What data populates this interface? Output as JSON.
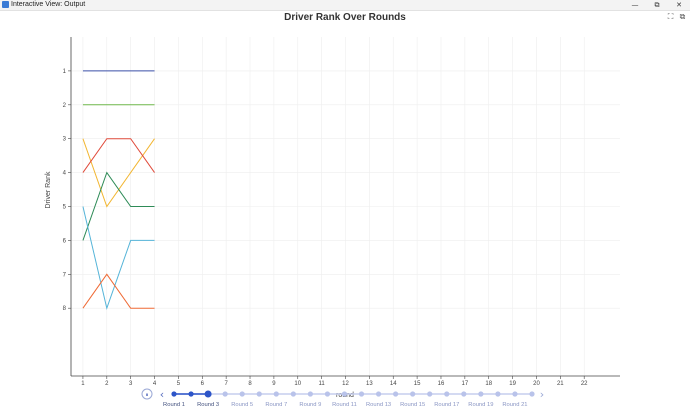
{
  "window": {
    "title": "Interactive View: Output",
    "minimize_glyph": "—",
    "restore_glyph": "⧉",
    "close_glyph": "✕"
  },
  "toolbar": {
    "icons": [
      "expand-icon",
      "export-icon"
    ]
  },
  "chart_data": {
    "type": "line",
    "title": "Driver Rank Over Rounds",
    "xlabel": "round",
    "ylabel": "Driver Rank",
    "x_ticks": [
      1,
      2,
      3,
      4,
      5,
      6,
      7,
      8,
      9,
      10,
      11,
      12,
      13,
      14,
      15,
      16,
      17,
      18,
      19,
      20,
      21,
      22
    ],
    "y_ticks": [
      1,
      2,
      3,
      4,
      5,
      6,
      7,
      8
    ],
    "xlim": [
      0.5,
      23.5
    ],
    "ylim": [
      0,
      10
    ],
    "y_inverted": true,
    "grid": true,
    "x": [
      1,
      2,
      3,
      4
    ],
    "series": [
      {
        "color": "#3b4fa8",
        "values": [
          1,
          1,
          1,
          1
        ]
      },
      {
        "color": "#6fb74b",
        "values": [
          2,
          2,
          2,
          2
        ]
      },
      {
        "color": "#f2b632",
        "values": [
          3,
          5,
          4,
          3
        ]
      },
      {
        "color": "#e04a3a",
        "values": [
          4,
          3,
          3,
          4
        ]
      },
      {
        "color": "#2e8b57",
        "values": [
          6,
          4,
          5,
          5
        ]
      },
      {
        "color": "#55b4d8",
        "values": [
          5,
          8,
          6,
          6
        ]
      },
      {
        "color": "#ef6a35",
        "values": [
          8,
          7,
          8,
          8
        ]
      }
    ]
  },
  "player": {
    "play_glyph": "⏸",
    "prev_glyph": "‹",
    "next_glyph": "›",
    "current_index": 2,
    "labels": [
      "Round 1",
      "Round 3",
      "Round 5",
      "Round 7",
      "Round 9",
      "Round 11",
      "Round 13",
      "Round 15",
      "Round 17",
      "Round 19",
      "Round 21"
    ]
  }
}
